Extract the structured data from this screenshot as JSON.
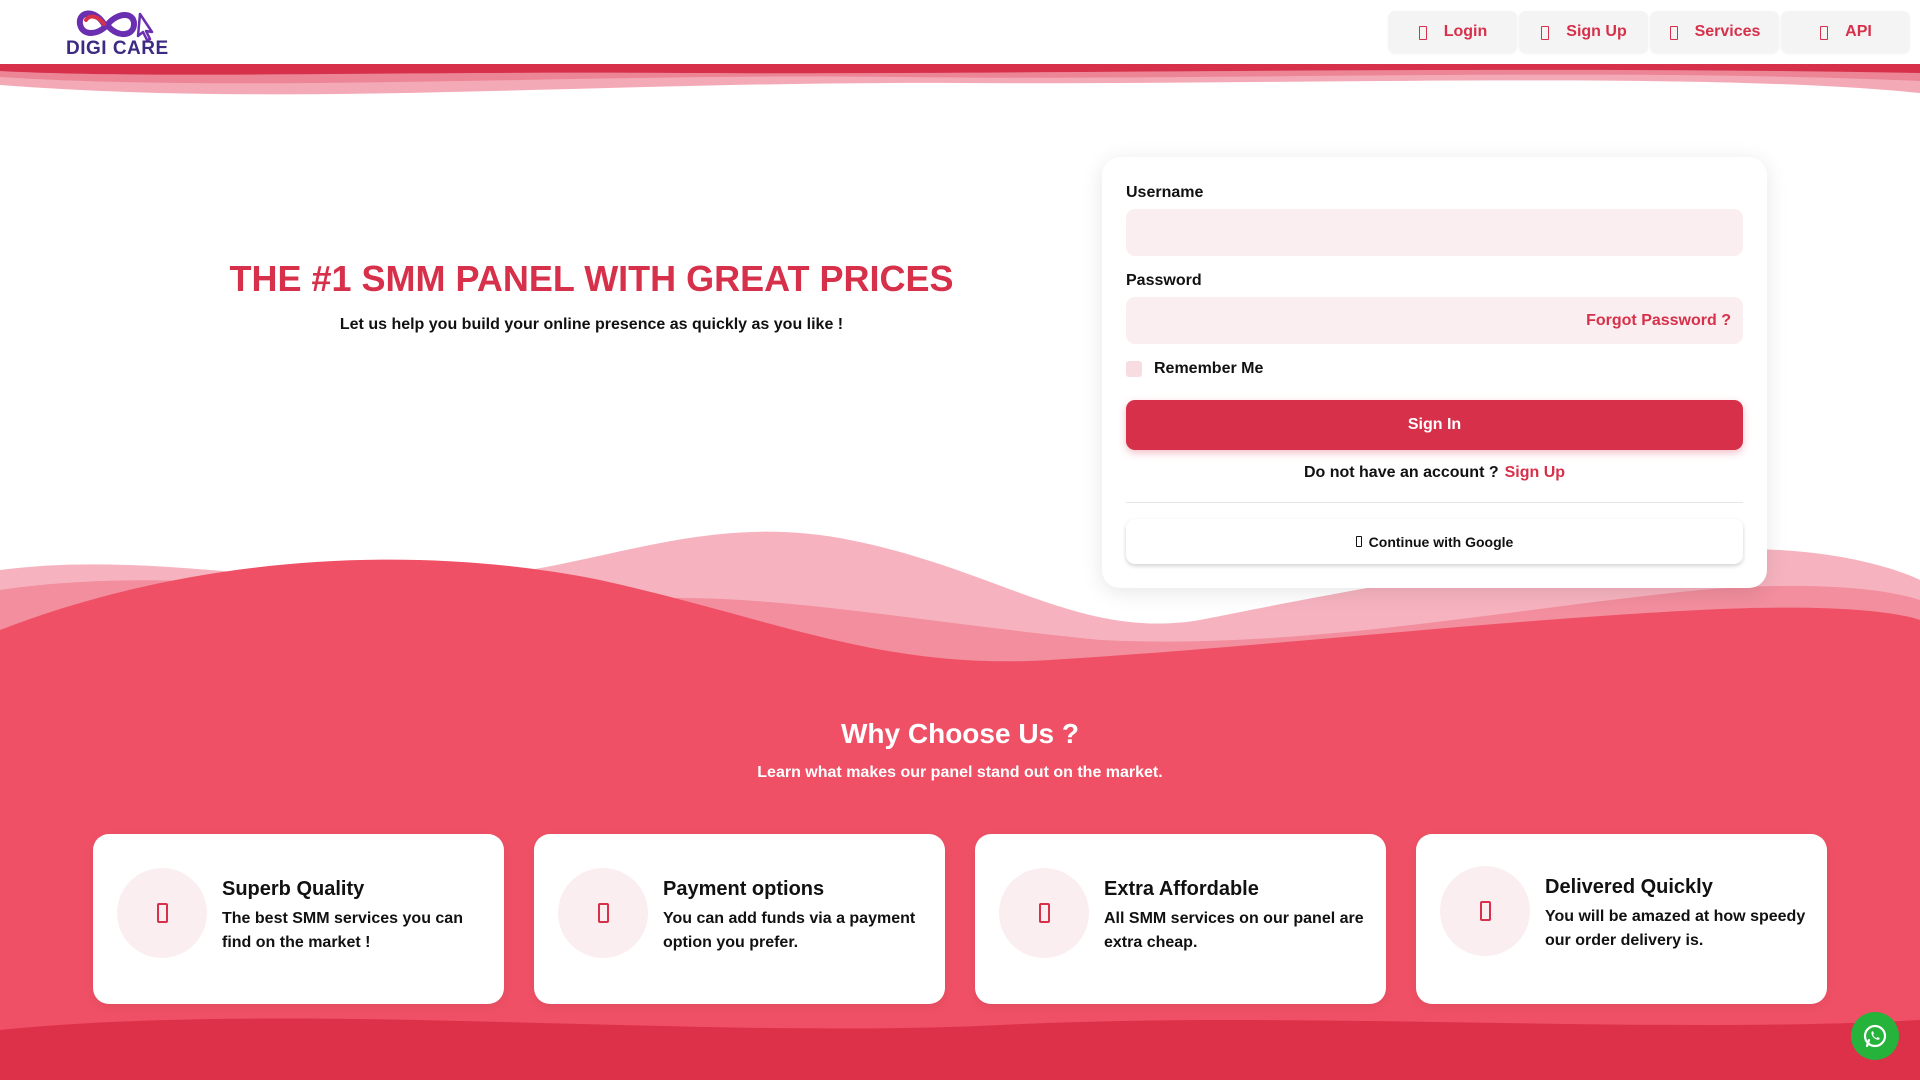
{
  "brand": {
    "name": "DIGI CARE",
    "primary_color": "#d6304a",
    "logo_color": "#3d2a82"
  },
  "nav": {
    "items": [
      {
        "label": "Login",
        "icon": "sign-in-icon"
      },
      {
        "label": "Sign Up",
        "icon": "user-plus-icon"
      },
      {
        "label": "Services",
        "icon": "list-icon"
      },
      {
        "label": "API",
        "icon": "code-icon"
      }
    ]
  },
  "hero": {
    "title": "THE #1 SMM PANEL WITH GREAT PRICES",
    "subtitle": "Let us help you build your online presence as quickly as you like !"
  },
  "login": {
    "username_label": "Username",
    "username_value": "",
    "password_label": "Password",
    "password_value": "",
    "forgot_label": "Forgot Password ?",
    "remember_label": "Remember Me",
    "remember_checked": false,
    "signin_label": "Sign In",
    "no_account_text": "Do not have an account ?",
    "signup_link": "Sign Up",
    "google_label": "Continue with Google"
  },
  "why": {
    "title": "Why Choose Us ?",
    "subtitle": "Learn what makes our panel stand out on the market.",
    "features": [
      {
        "title": "Superb Quality",
        "desc": "The best SMM services you can find on the market !",
        "icon": "star-icon"
      },
      {
        "title": "Payment options",
        "desc": "You can add funds via a payment option you prefer.",
        "icon": "credit-card-icon"
      },
      {
        "title": "Extra Affordable",
        "desc": "All SMM services on our panel are extra cheap.",
        "icon": "tag-icon"
      },
      {
        "title": "Delivered Quickly",
        "desc": "You will be amazed at how speedy our order delivery is.",
        "icon": "rocket-icon"
      }
    ]
  },
  "widgets": {
    "whatsapp_color": "#25b33c"
  }
}
